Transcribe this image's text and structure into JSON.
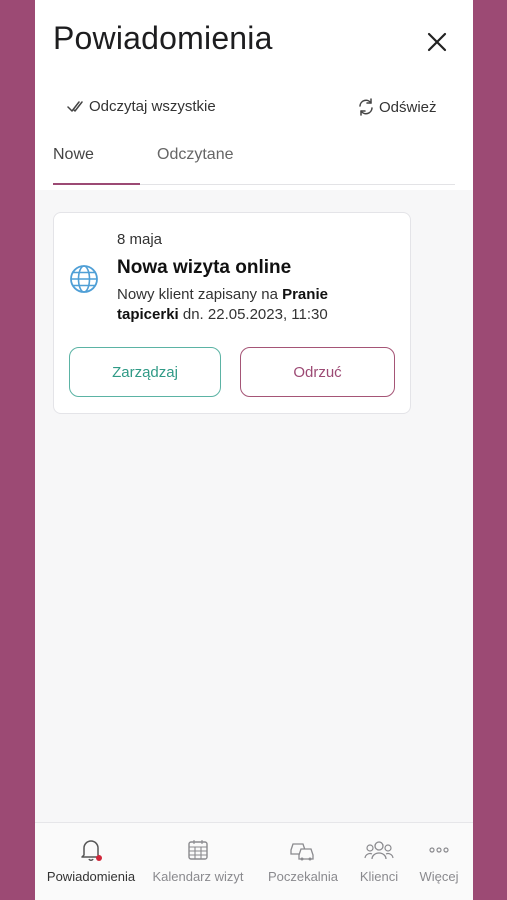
{
  "header": {
    "title": "Powiadomienia"
  },
  "actions": {
    "read_all": "Odczytaj wszystkie",
    "refresh": "Odśwież"
  },
  "tabs": [
    {
      "label": "Nowe",
      "active": true
    },
    {
      "label": "Odczytane",
      "active": false
    }
  ],
  "notification": {
    "date": "8 maja",
    "title": "Nowa wizyta online",
    "text_prefix": "Nowy klient zapisany na ",
    "service": "Pranie tapicerki",
    "text_suffix": " dn. 22.05.2023, 11:30",
    "icon": "globe-icon",
    "manage_label": "Zarządzaj",
    "reject_label": "Odrzuć"
  },
  "bottom_nav": [
    {
      "label": "Powiadomienia",
      "icon": "bell-icon",
      "active": true
    },
    {
      "label": "Kalendarz wizyt",
      "icon": "calendar-icon",
      "active": false
    },
    {
      "label": "Poczekalnia",
      "icon": "cars-icon",
      "active": false
    },
    {
      "label": "Klienci",
      "icon": "users-icon",
      "active": false
    },
    {
      "label": "Więcej",
      "icon": "more-icon",
      "active": false
    }
  ],
  "colors": {
    "background": "#9c4a74",
    "accent": "#9c4a74",
    "manage": "#2f9a86",
    "badge": "#d0263a"
  }
}
